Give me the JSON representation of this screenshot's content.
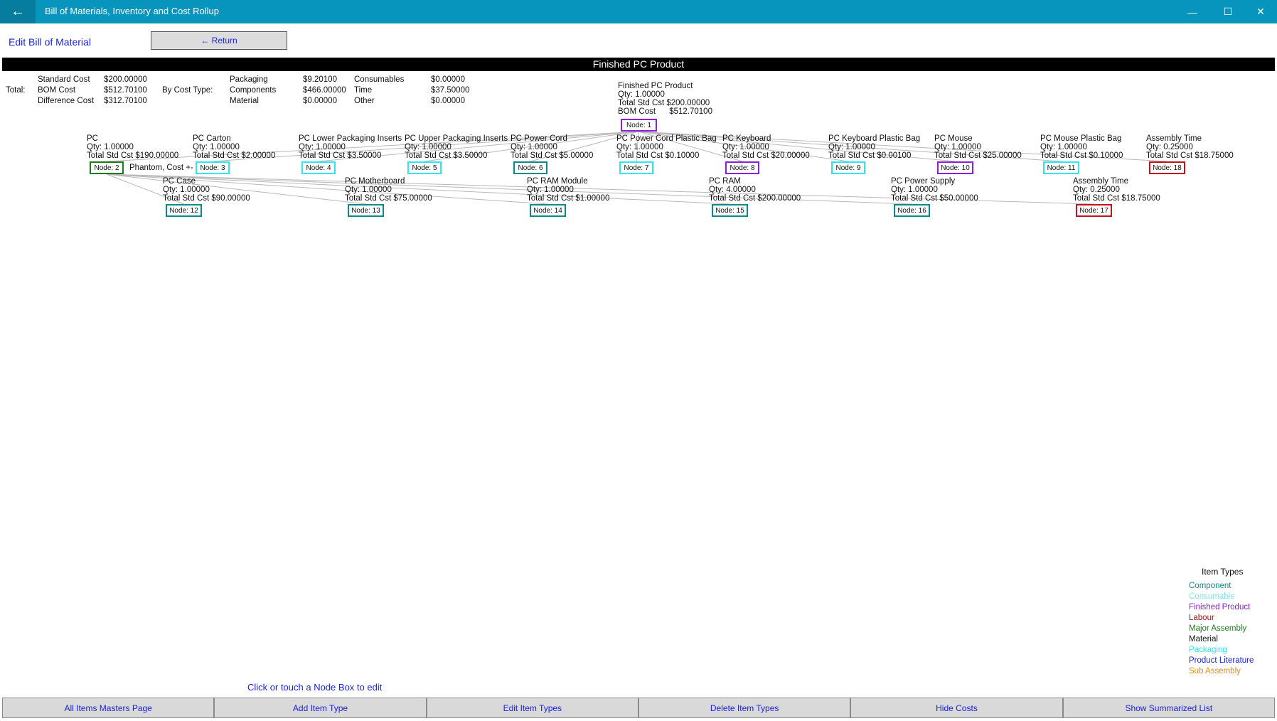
{
  "window": {
    "title": "Bill of Materials, Inventory and Cost Rollup",
    "back_icon": "←",
    "min_icon": "—",
    "max_icon": "☐",
    "close_icon": "✕"
  },
  "header": {
    "edit_label": "Edit Bill of Material",
    "return_label": "← Return",
    "bar_title": "Finished PC Product"
  },
  "summary": {
    "total_label": "Total:",
    "standard_label": "Standard Cost",
    "standard_value": "$200.00000",
    "bom_label": "BOM Cost",
    "bom_value": "$512.70100",
    "diff_label": "Difference Cost",
    "diff_value": "$312.70100",
    "bytype_label": "By Cost Type:",
    "packaging_label": "Packaging",
    "packaging_value": "$9.20100",
    "components_label": "Components",
    "components_value": "$466.00000",
    "material_label": "Material",
    "material_value": "$0.00000",
    "consumables_label": "Consumables",
    "consumables_value": "$0.00000",
    "time_label": "Time",
    "time_value": "$37.50000",
    "other_label": "Other",
    "other_value": "$0.00000"
  },
  "root": {
    "name": "Finished PC Product",
    "qty": "Qty: 1.00000",
    "std": "Total Std Cst $200.00000",
    "bom": "BOM Cost      $512.70100",
    "node": "Node: 1",
    "color": "#8b1fd6"
  },
  "phantom_label": "Phantom, Cost +-",
  "level1": [
    {
      "name": "PC",
      "qty": "Qty: 1.00000",
      "std": "Total Std Cst $190.00000",
      "node": "Node: 2",
      "color": "#1e7a1e"
    },
    {
      "name": "PC Carton",
      "qty": "Qty: 1.00000",
      "std": "Total Std Cst $2.00000",
      "node": "Node: 3",
      "color": "#2ee6f0"
    },
    {
      "name": "PC Lower Packaging Inserts",
      "qty": "Qty: 1.00000",
      "std": "Total Std Cst $3.50000",
      "node": "Node: 4",
      "color": "#2ee6f0"
    },
    {
      "name": "PC Upper Packaging Inserts",
      "qty": "Qty: 1.00000",
      "std": "Total Std Cst $3.50000",
      "node": "Node: 5",
      "color": "#2ee6f0"
    },
    {
      "name": "PC Power Cord",
      "qty": "Qty: 1.00000",
      "std": "Total Std Cst $5.00000",
      "node": "Node: 6",
      "color": "#0b8a8a"
    },
    {
      "name": "PC Power Cord Plastic Bag",
      "qty": "Qty: 1.00000",
      "std": "Total Std Cst $0.10000",
      "node": "Node: 7",
      "color": "#2ee6f0"
    },
    {
      "name": "PC Keyboard",
      "qty": "Qty: 1.00000",
      "std": "Total Std Cst $20.00000",
      "node": "Node: 8",
      "color": "#8b1fd6"
    },
    {
      "name": "PC Keyboard Plastic Bag",
      "qty": "Qty: 1.00000",
      "std": "Total Std Cst $0.00100",
      "node": "Node: 9",
      "color": "#2ee6f0"
    },
    {
      "name": "PC Mouse",
      "qty": "Qty: 1.00000",
      "std": "Total Std Cst $25.00000",
      "node": "Node: 10",
      "color": "#8b1fd6"
    },
    {
      "name": "PC Mouse Plastic Bag",
      "qty": "Qty: 1.00000",
      "std": "Total Std Cst $0.10000",
      "node": "Node: 11",
      "color": "#2ee6f0"
    },
    {
      "name": "Assembly Time",
      "qty": "Qty: 0.25000",
      "std": "Total Std Cst $18.75000",
      "node": "Node: 18",
      "color": "#c0141c"
    }
  ],
  "level2": [
    {
      "name": "PC Case",
      "qty": "Qty: 1.00000",
      "std": "Total Std Cst $90.00000",
      "node": "Node: 12",
      "color": "#0b8a8a"
    },
    {
      "name": "PC Motherboard",
      "qty": "Qty: 1.00000",
      "std": "Total Std Cst $75.00000",
      "node": "Node: 13",
      "color": "#0b8a8a"
    },
    {
      "name": "PC RAM Module",
      "qty": "Qty: 1.00000",
      "std": "Total Std Cst $1.00000",
      "node": "Node: 14",
      "color": "#0b8a8a"
    },
    {
      "name": "PC RAM",
      "qty": "Qty: 4.00000",
      "std": "Total Std Cst $200.00000",
      "node": "Node: 15",
      "color": "#0b8a8a"
    },
    {
      "name": "PC Power Supply",
      "qty": "Qty: 1.00000",
      "std": "Total Std Cst $50.00000",
      "node": "Node: 16",
      "color": "#0b8a8a"
    },
    {
      "name": "Assembly Time",
      "qty": "Qty: 0.25000",
      "std": "Total Std Cst $18.75000",
      "node": "Node: 17",
      "color": "#c0141c"
    }
  ],
  "legend": {
    "title": "Item Types",
    "items": [
      {
        "label": "Component",
        "color": "#0b8a8a"
      },
      {
        "label": "Consumable",
        "color": "#7fe6e6"
      },
      {
        "label": "Finished Product",
        "color": "#8b1fd6"
      },
      {
        "label": "Labour",
        "color": "#a01818"
      },
      {
        "label": "Major Assembly",
        "color": "#1e7a1e"
      },
      {
        "label": "Material",
        "color": "#111111"
      },
      {
        "label": "Packaging",
        "color": "#2ee6f0"
      },
      {
        "label": "Product Literature",
        "color": "#1a22e0"
      },
      {
        "label": "Sub Assembly",
        "color": "#e88a10"
      }
    ]
  },
  "hint": "Click or touch a Node Box to edit",
  "bottom_buttons": [
    "All Items Masters Page",
    "Add Item Type",
    "Edit Item Types",
    "Delete Item Types",
    "Hide Costs",
    "Show Summarized List"
  ]
}
